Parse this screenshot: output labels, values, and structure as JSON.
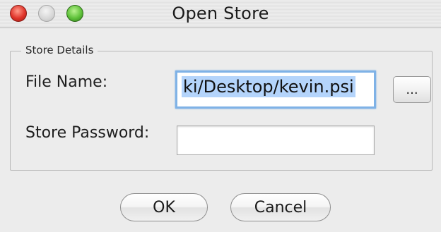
{
  "window": {
    "title": "Open Store"
  },
  "group": {
    "legend": "Store Details"
  },
  "file": {
    "label": "File Name:",
    "value": "ki/Desktop/kevin.psi",
    "browse_label": "..."
  },
  "password": {
    "label": "Store Password:",
    "value": ""
  },
  "buttons": {
    "ok_label": "OK",
    "cancel_label": "Cancel"
  },
  "colors": {
    "close": "#e0342a",
    "zoom": "#5fc13a",
    "focus_ring": "#7fb2e6",
    "selection": "#b4d4fb"
  }
}
